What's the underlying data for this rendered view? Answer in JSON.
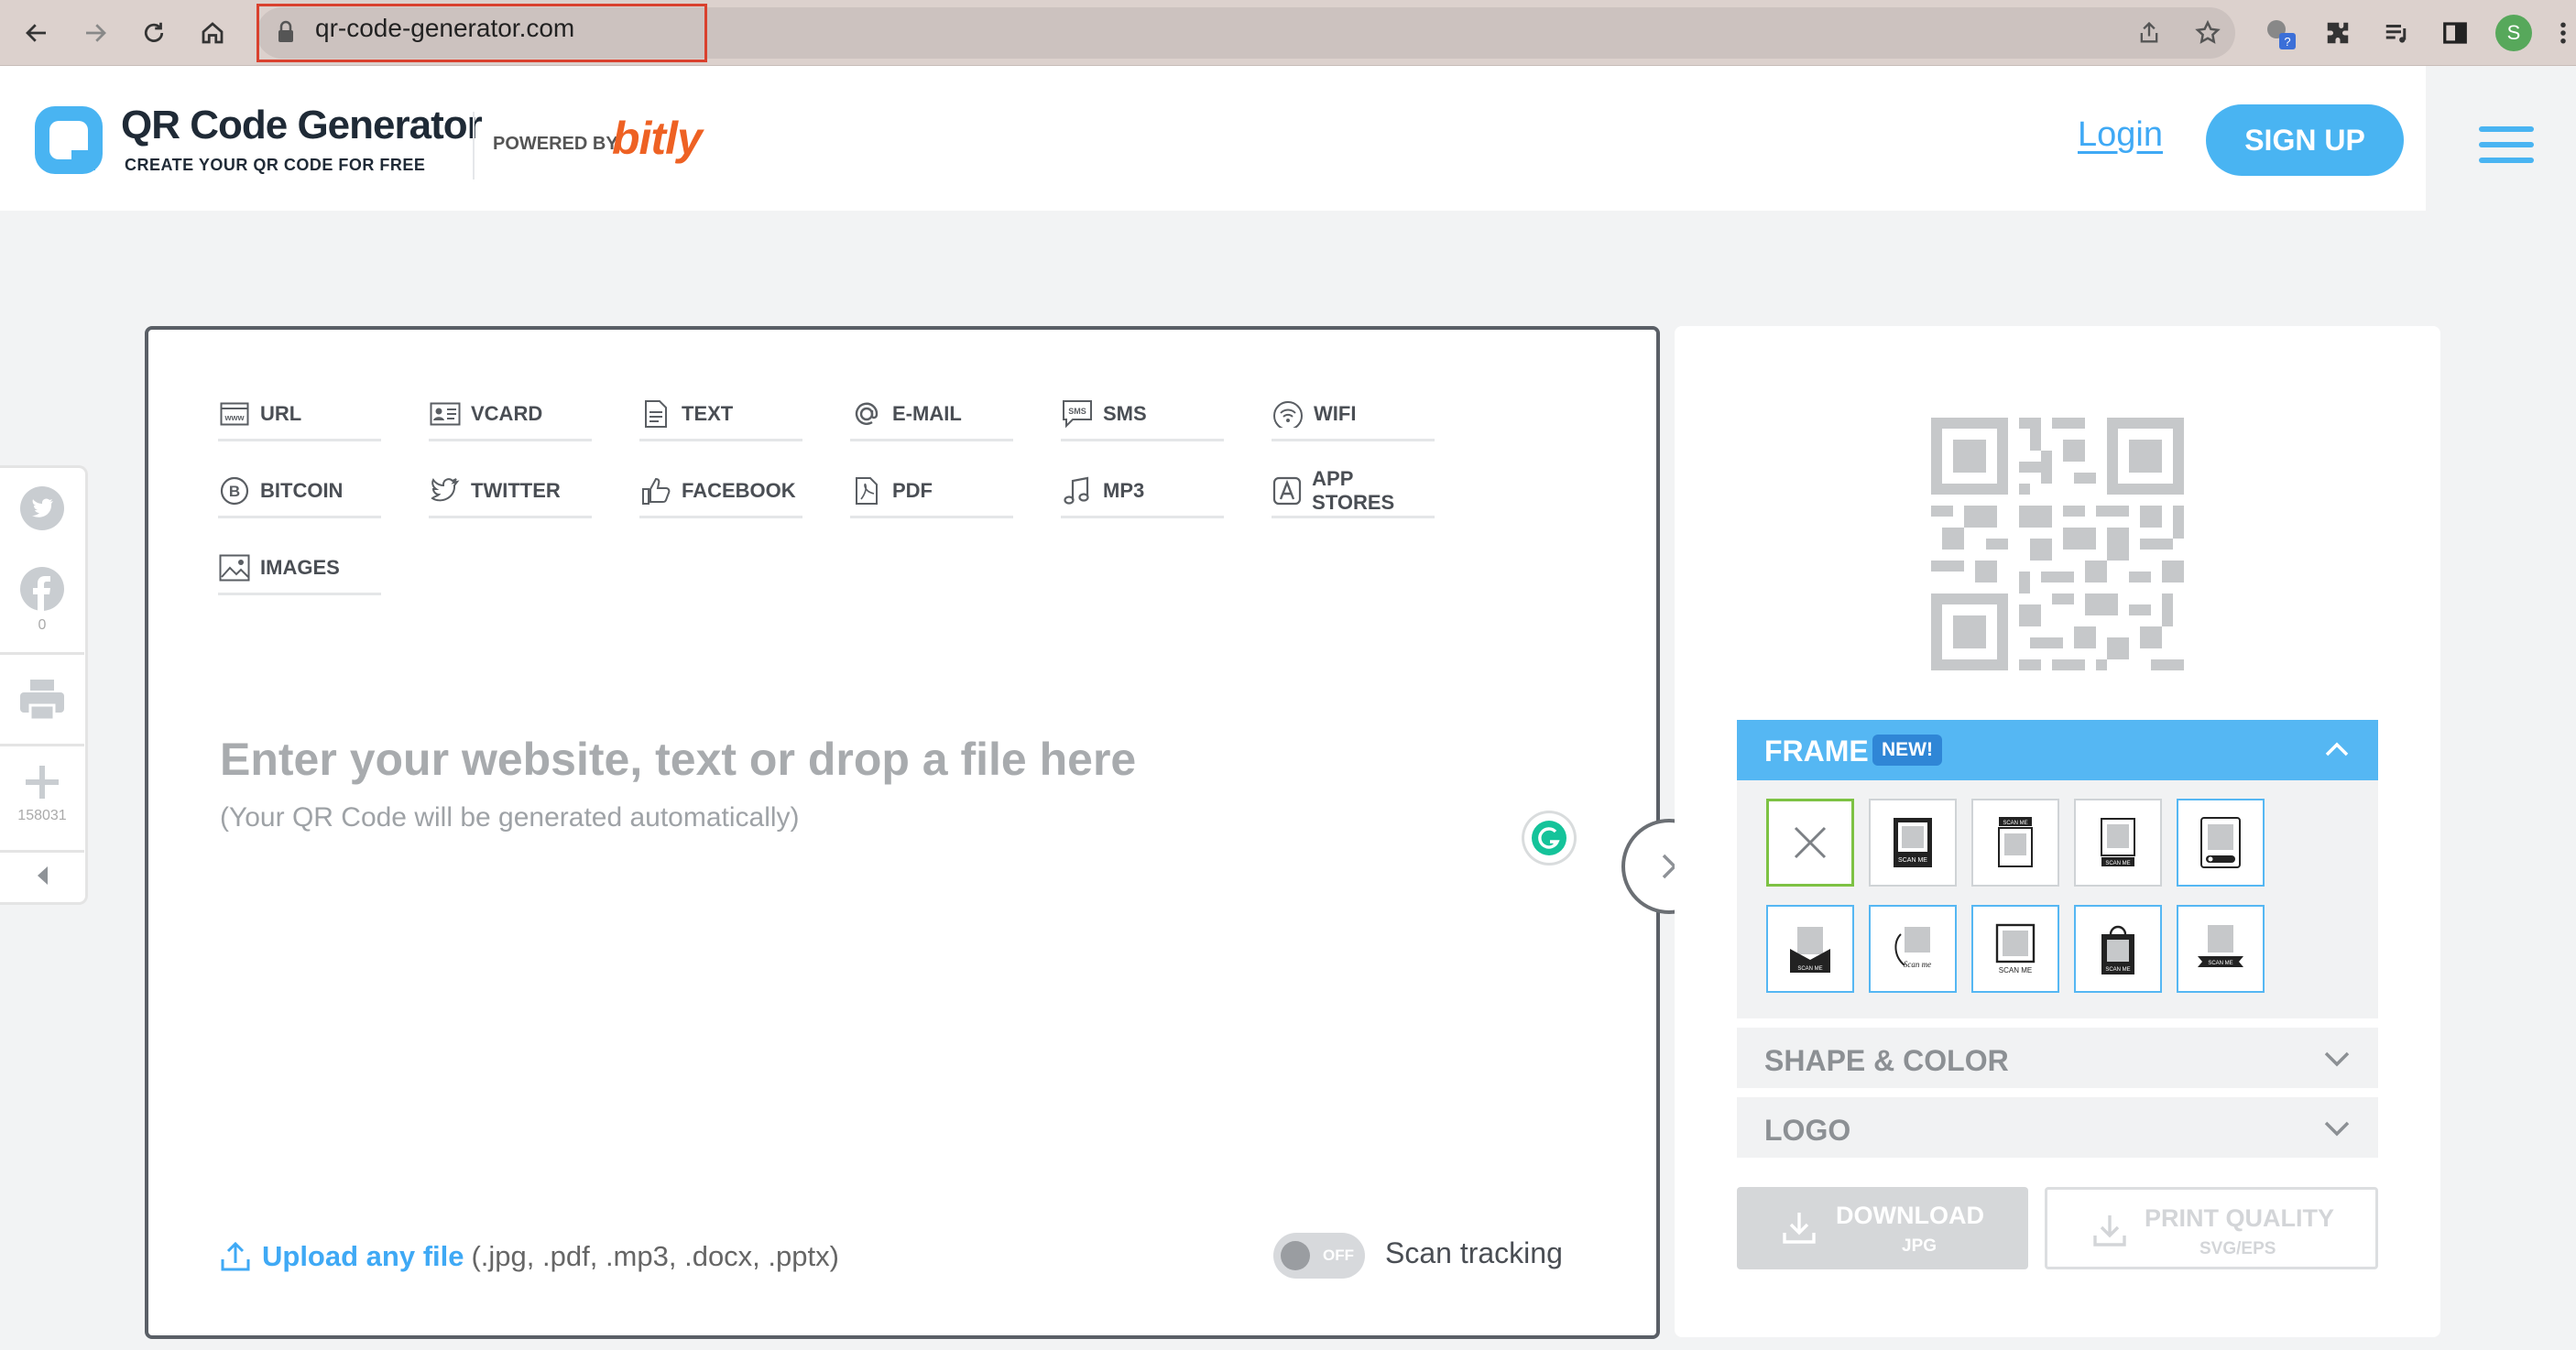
{
  "browser": {
    "url": "qr-code-generator.com",
    "profile_initial": "S",
    "extension_badge": "?"
  },
  "header": {
    "logo_title": "QR Code Generator",
    "logo_subtitle": "CREATE YOUR QR CODE FOR FREE",
    "powered_by": "POWERED BY",
    "partner": "bitly",
    "login": "Login",
    "signup": "SIGN UP"
  },
  "social": {
    "facebook_count": "0",
    "share_count": "158031"
  },
  "types": [
    {
      "label": "URL",
      "icon": "www-icon"
    },
    {
      "label": "VCARD",
      "icon": "vcard-icon"
    },
    {
      "label": "TEXT",
      "icon": "text-doc-icon"
    },
    {
      "label": "E-MAIL",
      "icon": "at-icon"
    },
    {
      "label": "SMS",
      "icon": "sms-icon"
    },
    {
      "label": "WIFI",
      "icon": "wifi-icon"
    },
    {
      "label": "BITCOIN",
      "icon": "bitcoin-icon"
    },
    {
      "label": "TWITTER",
      "icon": "twitter-icon"
    },
    {
      "label": "FACEBOOK",
      "icon": "thumbs-up-icon"
    },
    {
      "label": "PDF",
      "icon": "pdf-icon"
    },
    {
      "label": "MP3",
      "icon": "music-note-icon"
    },
    {
      "label": "APP STORES",
      "icon": "app-store-icon"
    },
    {
      "label": "IMAGES",
      "icon": "image-icon"
    }
  ],
  "input": {
    "title": "Enter your website, text or drop a file here",
    "subtitle": "(Your QR Code will be generated automatically)"
  },
  "upload": {
    "link": "Upload any file",
    "extensions": "(.jpg, .pdf, .mp3, .docx, .pptx)"
  },
  "tracking": {
    "toggle_state": "OFF",
    "label": "Scan tracking"
  },
  "frame": {
    "title": "FRAME",
    "badge": "NEW!",
    "options_label": "SCAN ME"
  },
  "accordions": {
    "shape_color": "SHAPE & COLOR",
    "logo": "LOGO"
  },
  "actions": {
    "download": "DOWNLOAD",
    "download_format": "JPG",
    "print": "PRINT QUALITY",
    "print_format": "SVG/EPS"
  },
  "colors": {
    "accent": "#49b4f2",
    "partner": "#ee6123",
    "frame_selected": "#7dc243"
  }
}
